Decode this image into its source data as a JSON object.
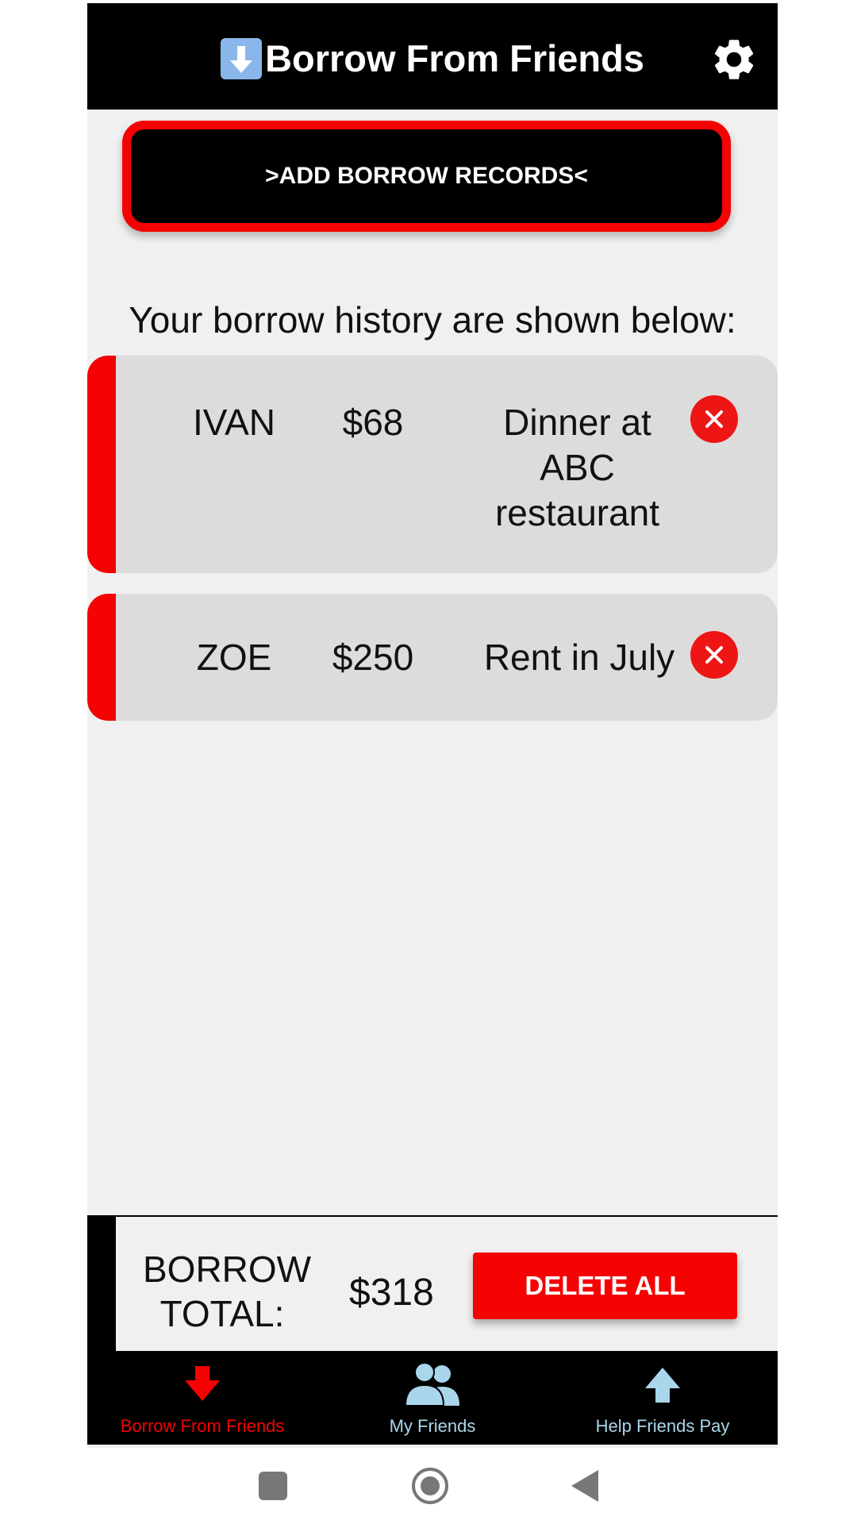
{
  "header": {
    "title": "Borrow From Friends",
    "title_icon": "down-arrow-icon",
    "settings_icon": "gear-icon"
  },
  "add_button_label": ">ADD BORROW RECORDS<",
  "history_label": "Your borrow history are shown below:",
  "records": [
    {
      "name": "IVAN",
      "amount": "$68",
      "description": "Dinner at ABC restaurant"
    },
    {
      "name": "ZOE",
      "amount": "$250",
      "description": "Rent in July"
    }
  ],
  "total": {
    "label": "BORROW TOTAL:",
    "amount": "$318",
    "delete_all_label": "DELETE ALL"
  },
  "bottom_nav": [
    {
      "label": "Borrow From Friends",
      "icon": "down-arrow-icon",
      "active": true
    },
    {
      "label": "My Friends",
      "icon": "people-icon",
      "active": false
    },
    {
      "label": "Help Friends Pay",
      "icon": "up-arrow-icon",
      "active": false
    }
  ],
  "colors": {
    "accent": "#f50202",
    "header_bg": "#000000",
    "nav_inactive": "#a9d6ea",
    "card_bg": "#dcdcdc"
  }
}
